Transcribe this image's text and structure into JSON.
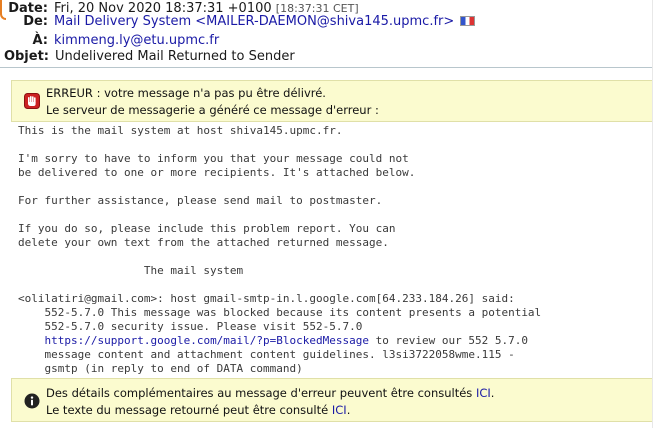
{
  "header": {
    "date": {
      "label": "Date:",
      "value": "Fri, 20 Nov 2020 18:37:31 +0100",
      "local_time": "[18:37:31 CET]"
    },
    "from": {
      "label": "De:",
      "value": "Mail Delivery System <MAILER-DAEMON@shiva145.upmc.fr>"
    },
    "to": {
      "label": "À:",
      "value": "kimmeng.ly@etu.upmc.fr"
    },
    "subject": {
      "label": "Objet:",
      "value": "Undelivered Mail Returned to Sender"
    }
  },
  "error_box": {
    "icon": "stop-hand-icon",
    "line1": "ERREUR : votre message n'a pas pu être délivré.",
    "line2": "Le serveur de messagerie a généré ce message d'erreur :"
  },
  "body": {
    "line01": "This is the mail system at host shiva145.upmc.fr.",
    "line02": "",
    "line03": "I'm sorry to have to inform you that your message could not",
    "line04": "be delivered to one or more recipients. It's attached below.",
    "line05": "",
    "line06": "For further assistance, please send mail to postmaster.",
    "line07": "",
    "line08": "If you do so, please include this problem report. You can",
    "line09": "delete your own text from the attached returned message.",
    "line10": "",
    "line11": "                   The mail system",
    "line12": "",
    "line13": "<olilatiri@gmail.com>: host gmail-smtp-in.l.google.com[64.233.184.26] said:",
    "line14": "    552-5.7.0 This message was blocked because its content presents a potential",
    "line15": "    552-5.7.0 security issue. Please visit 552-5.7.0",
    "line16_indent": "    ",
    "line16_link": "https://support.google.com/mail/?p=BlockedMessage",
    "line16_rest": " to review our 552 5.7.0",
    "line17": "    message content and attachment content guidelines. l3si3722058wme.115 -",
    "line18": "    gsmtp (in reply to end of DATA command)"
  },
  "info_box": {
    "icon": "info-icon",
    "line1_text": "Des détails complémentaires au message d'erreur peuvent être consultés ",
    "line1_link": "ICI",
    "line1_end": ".",
    "line2_text": "Le texte du message retourné peut être consulté ",
    "line2_link": "ICI",
    "line2_end": "."
  },
  "colors": {
    "link": "#1a1aa6",
    "notice_bg": "#fbfbcf",
    "error_icon": "#cc2222",
    "info_icon": "#222222"
  }
}
